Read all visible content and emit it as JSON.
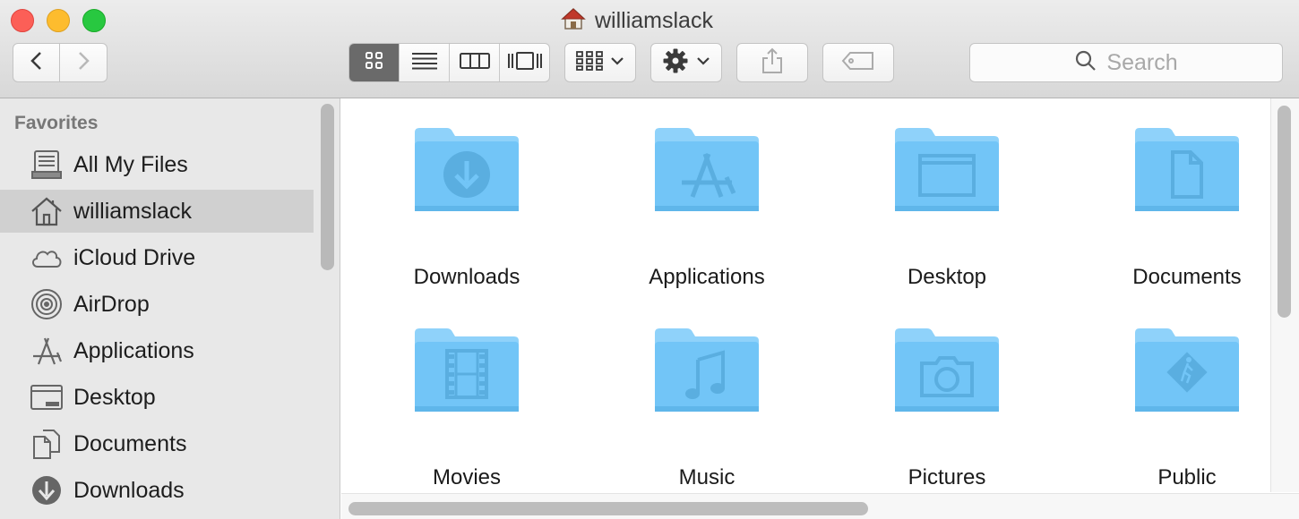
{
  "window": {
    "title": "williamslack"
  },
  "search": {
    "placeholder": "Search"
  },
  "sidebar": {
    "heading": "Favorites",
    "items": [
      {
        "label": "All My Files",
        "icon": "all-my-files-icon"
      },
      {
        "label": "williamslack",
        "icon": "home-icon",
        "selected": true
      },
      {
        "label": "iCloud Drive",
        "icon": "cloud-icon"
      },
      {
        "label": "AirDrop",
        "icon": "airdrop-icon"
      },
      {
        "label": "Applications",
        "icon": "applications-icon"
      },
      {
        "label": "Desktop",
        "icon": "desktop-icon"
      },
      {
        "label": "Documents",
        "icon": "documents-icon"
      },
      {
        "label": "Downloads",
        "icon": "downloads-icon"
      }
    ]
  },
  "folders": [
    {
      "label": "Downloads",
      "icon": "download-arrow-icon"
    },
    {
      "label": "Applications",
      "icon": "app-store-icon"
    },
    {
      "label": "Desktop",
      "icon": "window-icon"
    },
    {
      "label": "Documents",
      "icon": "document-page-icon"
    },
    {
      "label": "Movies",
      "icon": "film-strip-icon"
    },
    {
      "label": "Music",
      "icon": "music-note-icon"
    },
    {
      "label": "Pictures",
      "icon": "camera-icon"
    },
    {
      "label": "Public",
      "icon": "pedestrian-sign-icon"
    }
  ],
  "colors": {
    "folder": "#72c5f7",
    "folder_tab": "#8fd2fa",
    "folder_glyph": "#5aaee0",
    "close": "#fc5f57",
    "minimize": "#fdbc2e",
    "zoom": "#28c840",
    "selected_row": "#d0d0d0"
  }
}
